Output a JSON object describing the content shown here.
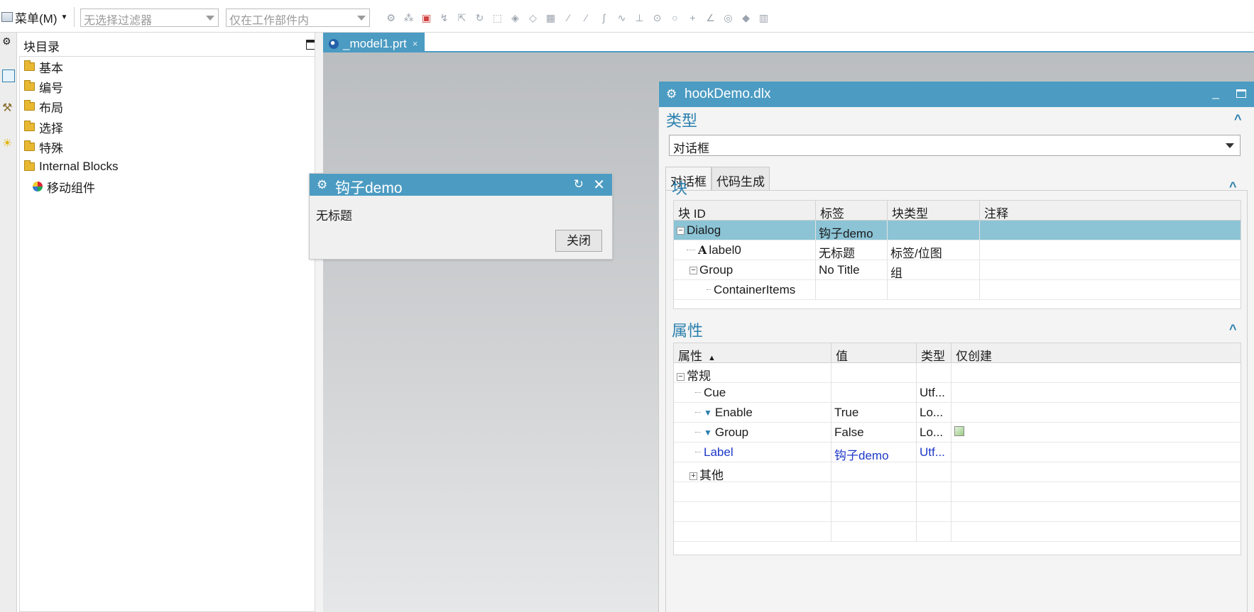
{
  "toolbar": {
    "menu_label": "菜单(M)",
    "filter_placeholder": "无选择过滤器",
    "scope_placeholder": "仅在工作部件内",
    "icons": [
      "snap-icon",
      "point-icon",
      "select-icon",
      "curve-icon",
      "move-icon",
      "rotate-icon",
      "box-select-icon",
      "view-icon",
      "shade-icon",
      "cube-icon",
      "line-icon",
      "tangent-icon",
      "spline-icon",
      "wave-icon",
      "perpendicular-icon",
      "circle-icon",
      "center-icon",
      "plus-icon",
      "angle-icon",
      "layer-icon",
      "filter-icon",
      "grid-icon"
    ]
  },
  "catalog": {
    "title": "块目录",
    "items": [
      {
        "label": "基本",
        "icon": "folder-icon"
      },
      {
        "label": "编号",
        "icon": "folder-icon"
      },
      {
        "label": "布局",
        "icon": "folder-icon"
      },
      {
        "label": "选择",
        "icon": "folder-icon"
      },
      {
        "label": "特殊",
        "icon": "folder-icon"
      },
      {
        "label": "Internal Blocks",
        "icon": "folder-open-icon"
      },
      {
        "label": "移动组件",
        "icon": "component-icon"
      }
    ]
  },
  "doc_tab": {
    "label": "_model1.prt",
    "close": "×"
  },
  "hook_dialog": {
    "title": "钩子demo",
    "label": "无标题",
    "close_button": "关闭"
  },
  "dlx": {
    "title": "hookDemo.dlx",
    "type_section": "类型",
    "type_value": "对话框",
    "tabs": [
      "对话框",
      "代码生成"
    ],
    "block_section": "块",
    "block_columns": [
      "块 ID",
      "标签",
      "块类型",
      "注释"
    ],
    "block_rows": [
      {
        "id": "Dialog",
        "label": "钩子demo",
        "type": "",
        "note": ""
      },
      {
        "id": "label0",
        "label": "无标题",
        "type": "标签/位图",
        "note": ""
      },
      {
        "id": "Group",
        "label": "No Title",
        "type": "组",
        "note": ""
      },
      {
        "id": "ContainerItems",
        "label": "",
        "type": "",
        "note": ""
      }
    ],
    "prop_section": "属性",
    "prop_columns": [
      "属性",
      "值",
      "类型",
      "仅创建"
    ],
    "prop_rows": [
      {
        "name": "常规",
        "value": "",
        "type": ""
      },
      {
        "name": "Cue",
        "value": "",
        "type": "Utf..."
      },
      {
        "name": "Enable",
        "value": "True",
        "type": "Lo..."
      },
      {
        "name": "Group",
        "value": "False",
        "type": "Lo..."
      },
      {
        "name": "Label",
        "value": "钩子demo",
        "type": "Utf..."
      },
      {
        "name": "其他",
        "value": "",
        "type": ""
      }
    ]
  },
  "colors": {
    "accent": "#4b9bc2",
    "section_text": "#2a7fae",
    "selected_row": "#8cc4d6",
    "changed_text": "#1d38c8"
  }
}
